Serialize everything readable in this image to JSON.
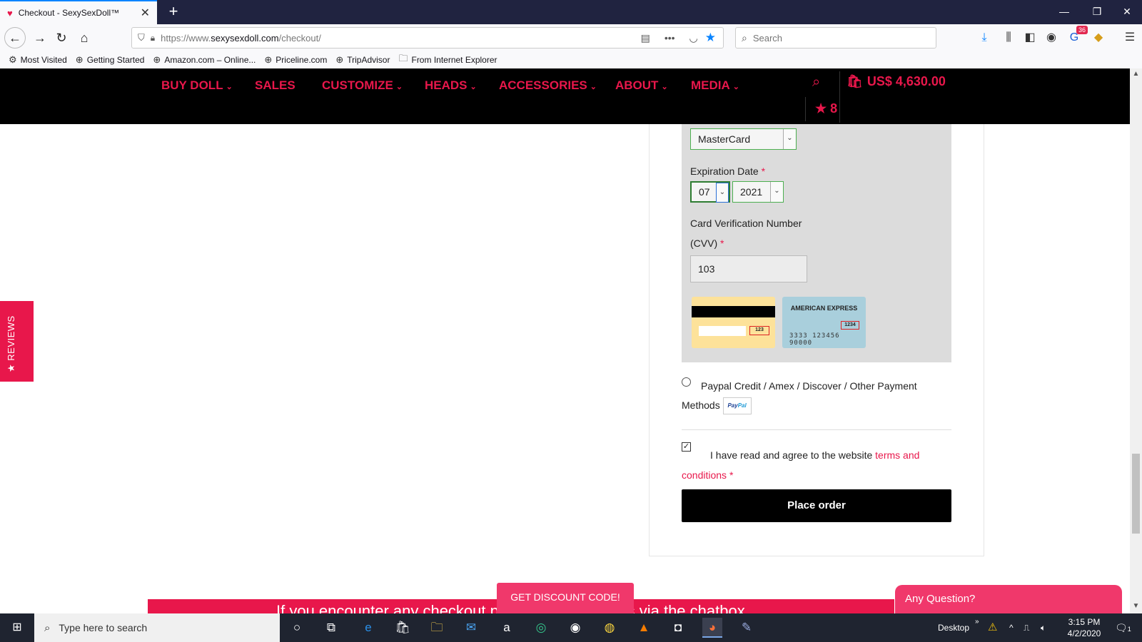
{
  "browser": {
    "tab_title": "Checkout - SexySexDoll™",
    "url_prefix": "https://www.",
    "url_domain": "sexysexdoll.com",
    "url_path": "/checkout/",
    "search_placeholder": "Search",
    "extension_badge": "36",
    "bookmarks": [
      "Most Visited",
      "Getting Started",
      "Amazon.com – Online...",
      "Priceline.com",
      "TripAdvisor",
      "From Internet Explorer"
    ]
  },
  "site": {
    "menu": [
      "BUY DOLL",
      "SALES",
      "CUSTOMIZE",
      "HEADS",
      "ACCESSORIES",
      "ABOUT",
      "MEDIA"
    ],
    "cart_total": "US$ 4,630.00",
    "wishlist_count": "8",
    "reviews_tab": "★ REVIEWS",
    "brand_color": "#e8174b"
  },
  "payment": {
    "card_type": "MasterCard",
    "expiration_label": "Expiration Date",
    "exp_month": "07",
    "exp_year": "2021",
    "cvv_label_line1": "Card Verification Number",
    "cvv_label_line2": "(CVV)",
    "required_mark": "*",
    "cvv_value": "103",
    "card_back_cvv": "123",
    "amex_title": "AMERICAN EXPRESS",
    "amex_cid": "1234",
    "amex_number": "3333 123456 90000",
    "paypal_option_label": "Paypal Credit / Amex / Discover / Other Payment Methods",
    "paypal_logo_a": "Pay",
    "paypal_logo_b": "Pal",
    "agree_text": "I have read and agree to the website ",
    "terms_link": "terms and conditions",
    "place_order": "Place order"
  },
  "footer": {
    "discount_button": "GET DISCOUNT CODE!",
    "banner_text": "If you encounter any checkout problems, contact us via the chatbox",
    "question_button": "Any Question?"
  },
  "taskbar": {
    "search_placeholder": "Type here to search",
    "desktop_label": "Desktop",
    "time": "3:15 PM",
    "date": "4/2/2020",
    "notification_count": "1"
  }
}
